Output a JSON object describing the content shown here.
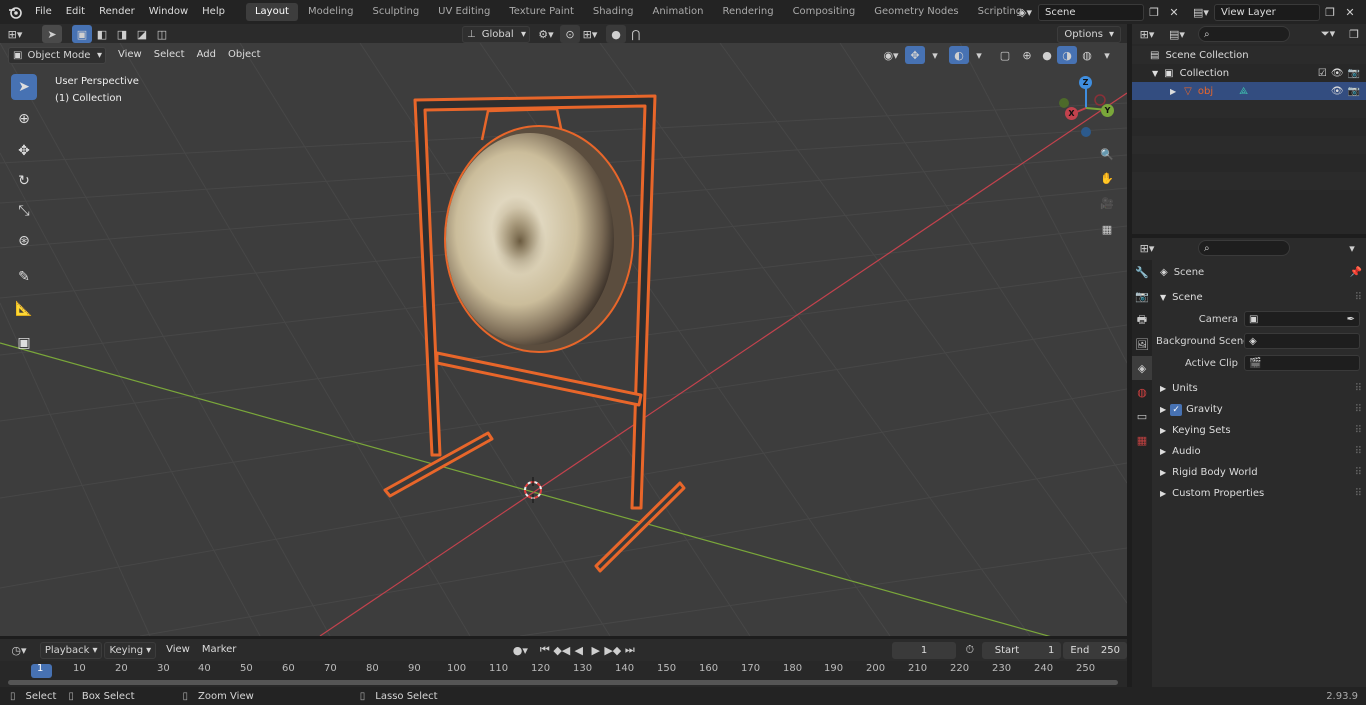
{
  "topbar": {
    "menus": [
      "File",
      "Edit",
      "Render",
      "Window",
      "Help"
    ],
    "workspaces": [
      "Layout",
      "Modeling",
      "Sculpting",
      "UV Editing",
      "Texture Paint",
      "Shading",
      "Animation",
      "Rendering",
      "Compositing",
      "Geometry Nodes",
      "Scripting"
    ],
    "active_workspace": "Layout",
    "add_tab": "+",
    "scene_name": "Scene",
    "view_layer": "View Layer"
  },
  "toolbar_row": {
    "transform_orientation": "Global",
    "options": "Options"
  },
  "viewport_header": {
    "mode": "Object Mode",
    "menus": [
      "View",
      "Select",
      "Add",
      "Object"
    ]
  },
  "viewport": {
    "perspective": "User Perspective",
    "collection": "(1) Collection",
    "gizmo_labels": {
      "z": "Z",
      "y": "Y",
      "x": "X"
    }
  },
  "outliner": {
    "items": [
      {
        "label": "Scene Collection"
      },
      {
        "label": "Collection"
      },
      {
        "label": "obj"
      }
    ]
  },
  "properties": {
    "context_label": "Scene",
    "panel_title": "Scene",
    "fields": [
      {
        "label": "Camera",
        "value": ""
      },
      {
        "label": "Background Scene",
        "value": ""
      },
      {
        "label": "Active Clip",
        "value": ""
      }
    ],
    "panels": [
      "Units",
      "Gravity",
      "Keying Sets",
      "Audio",
      "Rigid Body World",
      "Custom Properties"
    ]
  },
  "timeline": {
    "menus": [
      "Playback",
      "Keying",
      "View",
      "Marker"
    ],
    "current_frame": "1",
    "start_label": "Start",
    "start_value": "1",
    "end_label": "End",
    "end_value": "250",
    "ticks": [
      "1",
      "10",
      "20",
      "30",
      "40",
      "50",
      "60",
      "70",
      "80",
      "90",
      "100",
      "110",
      "120",
      "130",
      "140",
      "150",
      "160",
      "170",
      "180",
      "190",
      "200",
      "210",
      "220",
      "230",
      "240",
      "250"
    ]
  },
  "statusbar": {
    "select": "Select",
    "box_select": "Box Select",
    "zoom_view": "Zoom View",
    "lasso_select": "Lasso Select",
    "version": "2.93.9"
  },
  "colors": {
    "selection_orange": "#e8662a",
    "x_axis": "#c2424d",
    "y_axis": "#7aa73a",
    "z_axis": "#3f8ee0",
    "active_blue": "#4772b3"
  }
}
